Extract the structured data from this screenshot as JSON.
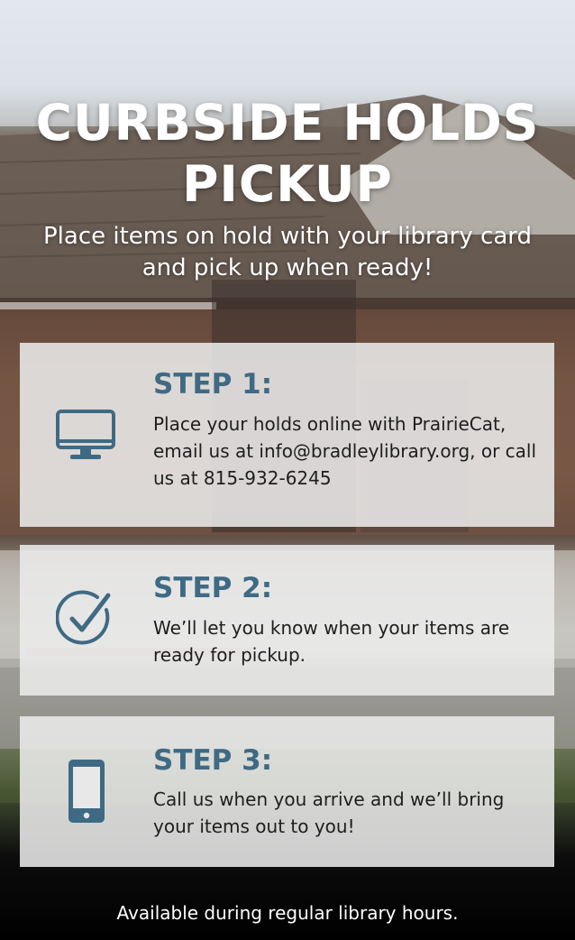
{
  "title_line1": "CURBSIDE HOLDS",
  "title_line2": "PICKUP",
  "subtitle": "Place items on hold with your library card and pick up when ready!",
  "steps": [
    {
      "heading": "STEP 1:",
      "text": "Place your holds online with PrairieCat, email us at info@bradleylibrary.org, or call us at 815-932-6245",
      "icon": "computer-monitor-icon"
    },
    {
      "heading": "STEP 2:",
      "text": "We’ll let you know when your items are ready for pickup.",
      "icon": "checkmark-circle-icon"
    },
    {
      "heading": "STEP 3:",
      "text": "Call us when you arrive and we’ll bring your items out to you!",
      "icon": "smartphone-icon"
    }
  ],
  "footer": "Available during regular library hours.",
  "colors": {
    "accent": "#3f6a84",
    "card": "#ececec",
    "text": "#1e1e1e"
  }
}
